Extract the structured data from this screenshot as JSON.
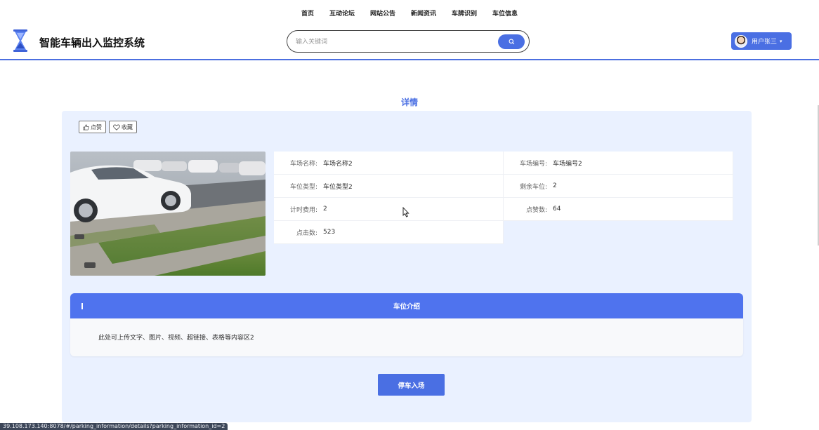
{
  "nav": {
    "items": [
      "首页",
      "互动论坛",
      "网站公告",
      "新闻资讯",
      "车牌识别",
      "车位信息"
    ]
  },
  "header": {
    "title": "智能车辆出入监控系统",
    "search_placeholder": "输入关键词",
    "user_label": "用户张三",
    "caret": "▾"
  },
  "page": {
    "title": "详情"
  },
  "actions": {
    "like_label": "点赞",
    "favorite_label": "收藏"
  },
  "info": {
    "rows": [
      [
        {
          "label": "车场名称:",
          "value": "车场名称2"
        },
        {
          "label": "车场编号:",
          "value": "车场编号2"
        }
      ],
      [
        {
          "label": "车位类型:",
          "value": "车位类型2"
        },
        {
          "label": "剩余车位:",
          "value": "2"
        }
      ],
      [
        {
          "label": "计时费用:",
          "value": "2"
        },
        {
          "label": "点赞数:",
          "value": "64"
        }
      ],
      [
        {
          "label": "点击数:",
          "value": "523"
        }
      ]
    ]
  },
  "intro": {
    "title": "车位介绍",
    "content": "此处可上传文字、图片、视频、超链接、表格等内容区2"
  },
  "park_button": "停车入场",
  "status_url": "39.108.173.140:8078/#/parking_information/details?parking_information_id=2",
  "colors": {
    "accent": "#4a6fe3",
    "panel_bg": "#eaf1ff",
    "intro_header": "#4f73ee"
  }
}
